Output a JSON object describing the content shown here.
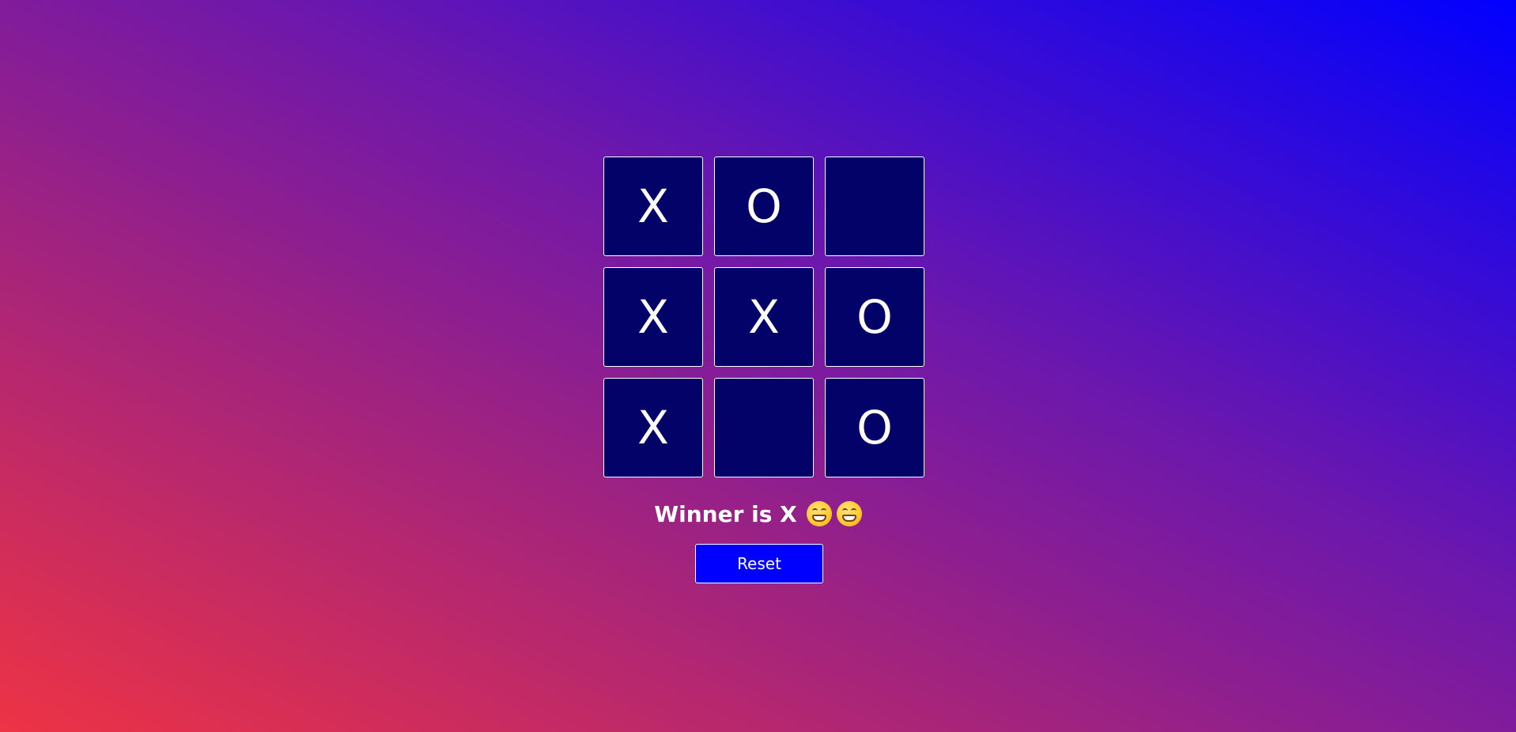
{
  "board": {
    "cells": [
      "X",
      "O",
      "",
      "X",
      "X",
      "O",
      "X",
      "",
      "O"
    ]
  },
  "status": {
    "text": "Winner is X",
    "emojis": [
      "grinning-face-icon",
      "grinning-face-icon"
    ]
  },
  "controls": {
    "reset_label": "Reset"
  },
  "colors": {
    "cell_background": "#020269",
    "reset_button": "#0000ff",
    "gradient_start": "#ee3344",
    "gradient_end": "#0000ff"
  }
}
